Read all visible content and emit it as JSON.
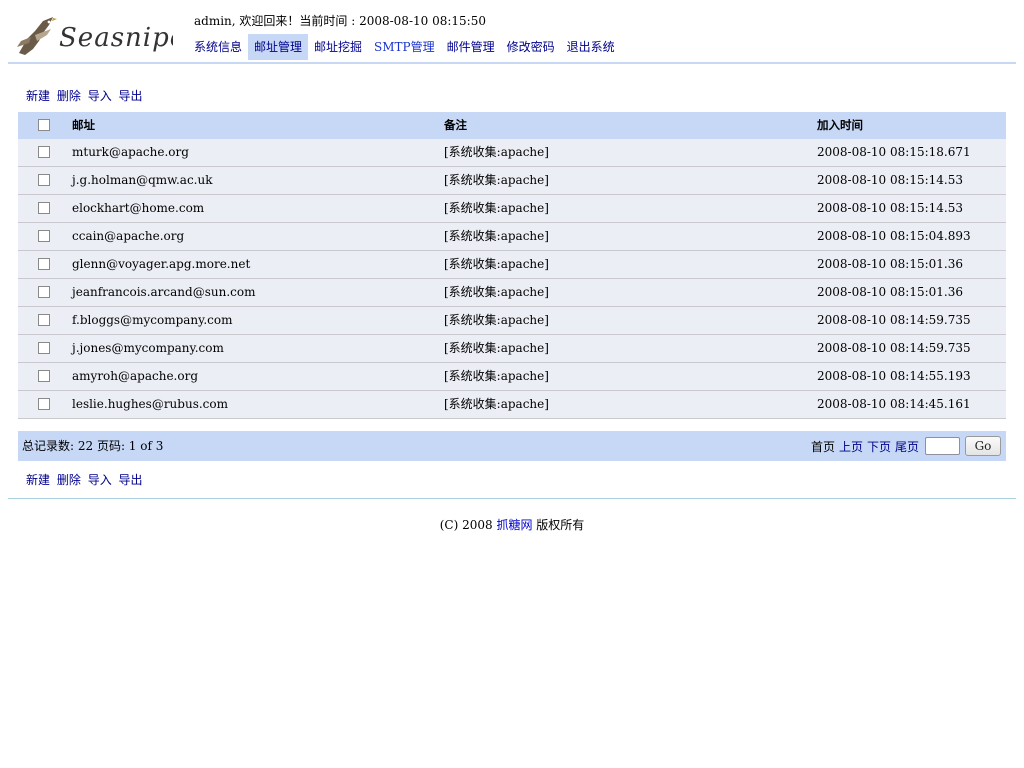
{
  "brand": {
    "logo_text": "Seasnipe"
  },
  "header": {
    "welcome": "admin, 欢迎回来！当前时间 : 2008-08-10 08:15:50"
  },
  "nav": [
    {
      "label": "系统信息",
      "active": false
    },
    {
      "label": "邮址管理",
      "active": true
    },
    {
      "label": "邮址挖掘",
      "active": false
    },
    {
      "label": "SMTP管理",
      "active": false
    },
    {
      "label": "邮件管理",
      "active": false
    },
    {
      "label": "修改密码",
      "active": false
    },
    {
      "label": "退出系统",
      "active": false
    }
  ],
  "actions": {
    "new": "新建",
    "delete": "删除",
    "import": "导入",
    "export": "导出"
  },
  "table": {
    "headers": {
      "email": "邮址",
      "note": "备注",
      "time": "加入时间"
    },
    "rows": [
      {
        "email": "mturk@apache.org",
        "note": "[系统收集:apache]",
        "time": "2008-08-10 08:15:18.671"
      },
      {
        "email": "j.g.holman@qmw.ac.uk",
        "note": "[系统收集:apache]",
        "time": "2008-08-10 08:15:14.53"
      },
      {
        "email": "elockhart@home.com",
        "note": "[系统收集:apache]",
        "time": "2008-08-10 08:15:14.53"
      },
      {
        "email": "ccain@apache.org",
        "note": "[系统收集:apache]",
        "time": "2008-08-10 08:15:04.893"
      },
      {
        "email": "glenn@voyager.apg.more.net",
        "note": "[系统收集:apache]",
        "time": "2008-08-10 08:15:01.36"
      },
      {
        "email": "jeanfrancois.arcand@sun.com",
        "note": "[系统收集:apache]",
        "time": "2008-08-10 08:15:01.36"
      },
      {
        "email": "f.bloggs@mycompany.com",
        "note": "[系统收集:apache]",
        "time": "2008-08-10 08:14:59.735"
      },
      {
        "email": "j.jones@mycompany.com",
        "note": "[系统收集:apache]",
        "time": "2008-08-10 08:14:59.735"
      },
      {
        "email": "amyroh@apache.org",
        "note": "[系统收集:apache]",
        "time": "2008-08-10 08:14:55.193"
      },
      {
        "email": "leslie.hughes@rubus.com",
        "note": "[系统收集:apache]",
        "time": "2008-08-10 08:14:45.161"
      }
    ]
  },
  "pager": {
    "info": "总记录数: 22 页码: 1 of 3",
    "first": "首页",
    "prev": "上页",
    "next": "下页",
    "last": "尾页",
    "page_value": "",
    "go": "Go"
  },
  "footer": {
    "copyright_prefix": "(C) 2008 ",
    "site_link": "抓糖网",
    "copyright_suffix": " 版权所有"
  },
  "colors": {
    "accent": "#c7d8f6",
    "row_bg": "#eceef5",
    "link": "#00008b"
  }
}
